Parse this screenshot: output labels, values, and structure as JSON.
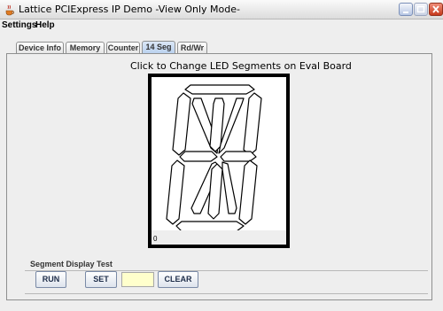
{
  "window": {
    "title": "Lattice PCIExpress IP Demo -View Only Mode-",
    "icon": "java-coffee-icon",
    "controls": [
      "minimize-icon",
      "maximize-icon",
      "close-icon"
    ],
    "close_color": "#d9482b"
  },
  "menu": {
    "items": [
      "Settings",
      "Help"
    ]
  },
  "tabs": {
    "items": [
      "Device Info",
      "Memory",
      "Counter",
      "14 Seg",
      "Rd/Wr"
    ],
    "active_index": 3,
    "active_color": "#c7daf2"
  },
  "main": {
    "heading": "Click to Change LED Segments on Eval Board",
    "display": {
      "value": "0",
      "segments": 14,
      "lit_segments": []
    }
  },
  "test": {
    "group_title": "Segment Display Test",
    "run_label": "RUN",
    "set_label": "SET",
    "input_value": "",
    "input_color": "#ffffcc",
    "clear_label": "CLEAR"
  }
}
